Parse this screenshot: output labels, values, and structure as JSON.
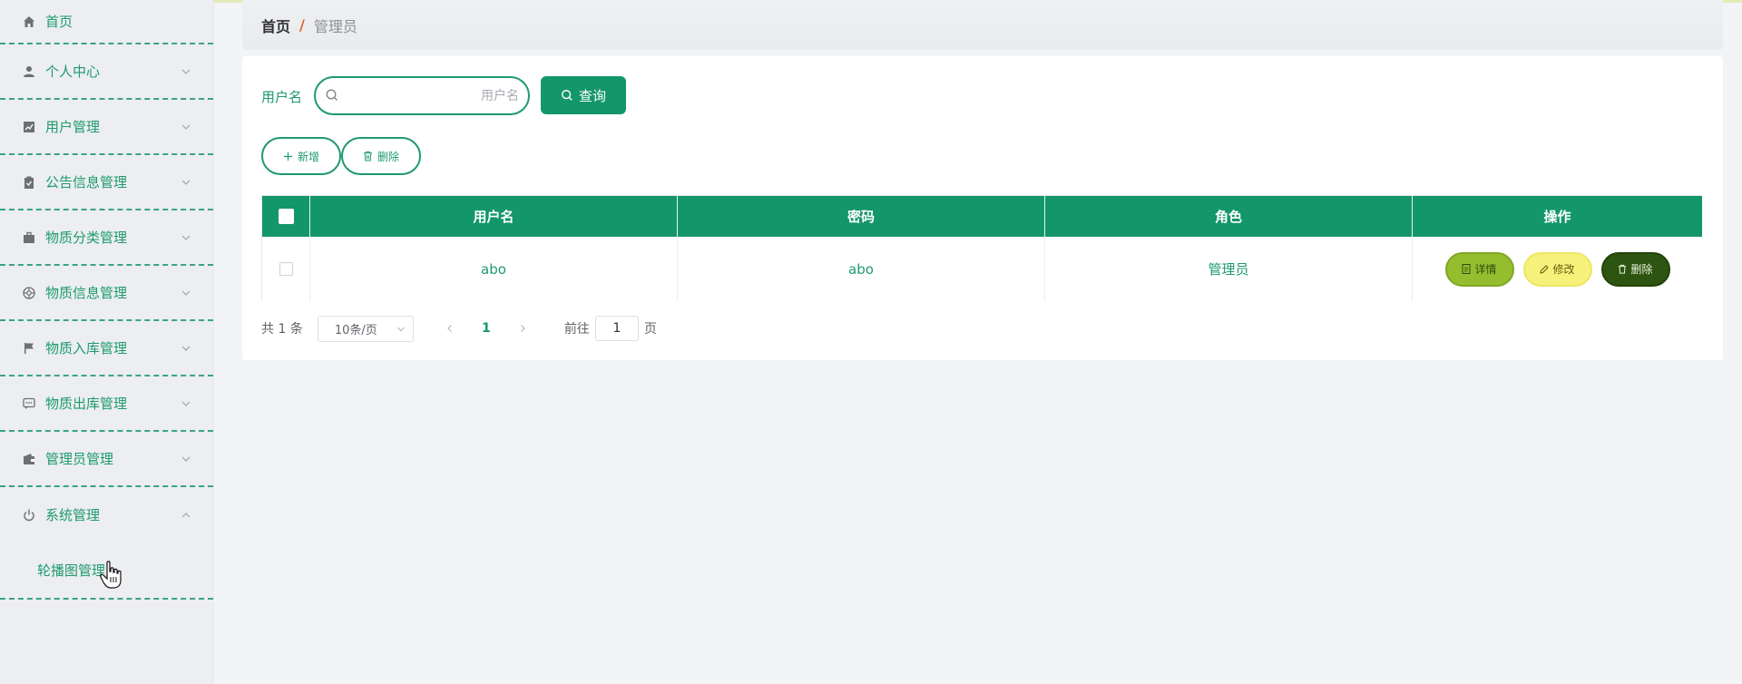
{
  "sidebar": {
    "items": [
      {
        "label": "首页",
        "icon": "home-icon"
      },
      {
        "label": "个人中心",
        "icon": "user-icon"
      },
      {
        "label": "用户管理",
        "icon": "chart-icon"
      },
      {
        "label": "公告信息管理",
        "icon": "clipboard-icon"
      },
      {
        "label": "物质分类管理",
        "icon": "briefcase-icon"
      },
      {
        "label": "物质信息管理",
        "icon": "aperture-icon"
      },
      {
        "label": "物质入库管理",
        "icon": "flag-icon"
      },
      {
        "label": "物质出库管理",
        "icon": "chat-icon"
      },
      {
        "label": "管理员管理",
        "icon": "wallet-icon"
      },
      {
        "label": "系统管理",
        "icon": "power-icon"
      }
    ],
    "submenu": {
      "label": "轮播图管理"
    }
  },
  "breadcrumb": {
    "home": "首页",
    "separator": "/",
    "current": "管理员"
  },
  "search": {
    "label": "用户名",
    "placeholder": "用户名",
    "value": "",
    "button_label": "查询"
  },
  "toolbar": {
    "add_label": "新增",
    "delete_label": "删除"
  },
  "table": {
    "columns": [
      "用户名",
      "密码",
      "角色",
      "操作"
    ],
    "rows": [
      {
        "username": "abo",
        "password": "abo",
        "role": "管理员"
      }
    ],
    "actions": {
      "detail": "详情",
      "edit": "修改",
      "delete": "删除"
    }
  },
  "pagination": {
    "total": "共 1 条",
    "page_size": "10条/页",
    "current_page": "1",
    "goto_label": "前往",
    "goto_value": "1",
    "page_suffix": "页"
  },
  "colors": {
    "primary": "#13966a",
    "sidebar_text": "#1e9a6d",
    "detail_btn": "#95bd2f",
    "edit_btn": "#f6f17a",
    "delete_btn": "#2d5410",
    "breadcrumb_separator": "#e0602f"
  }
}
